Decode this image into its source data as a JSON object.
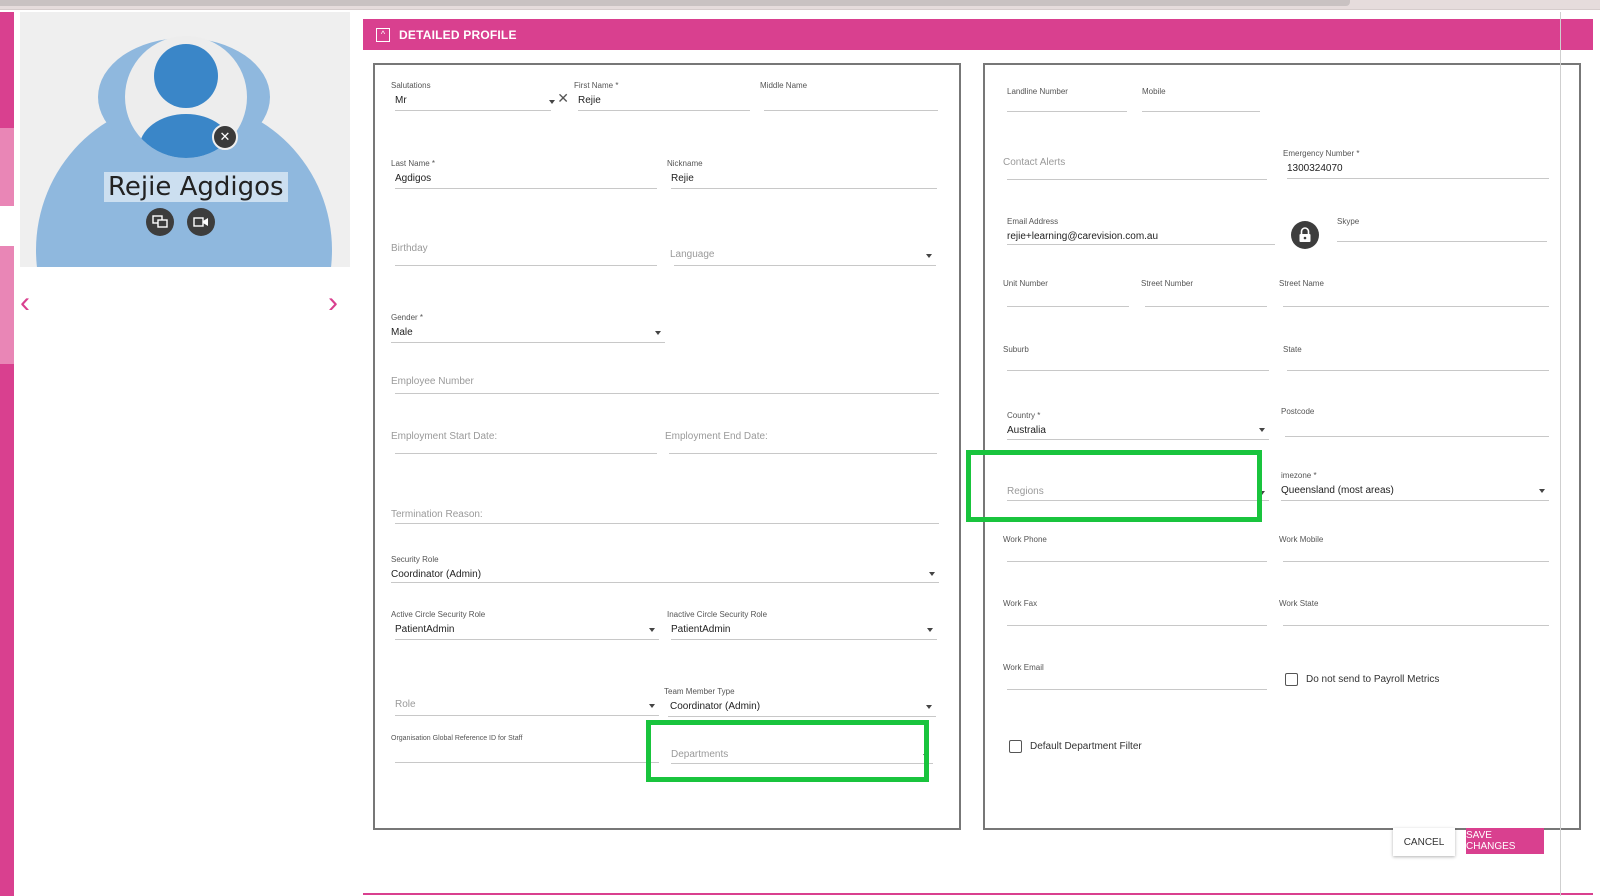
{
  "person": {
    "name": "Rejie Agdigos"
  },
  "panel": {
    "title": "DETAILED PROFILE"
  },
  "left": {
    "salutation": {
      "label": "Salutations",
      "value": "Mr"
    },
    "first_name": {
      "label": "First Name *",
      "value": "Rejie"
    },
    "middle_name": {
      "label": "Middle Name"
    },
    "last_name": {
      "label": "Last Name *",
      "value": "Agdigos"
    },
    "nickname": {
      "label": "Nickname",
      "value": "Rejie"
    },
    "birthday": {
      "placeholder": "Birthday"
    },
    "language": {
      "placeholder": "Language"
    },
    "gender": {
      "label": "Gender *",
      "value": "Male"
    },
    "employee_number": {
      "placeholder": "Employee Number"
    },
    "employment_start": {
      "placeholder": "Employment Start Date:"
    },
    "employment_end": {
      "placeholder": "Employment End Date:"
    },
    "termination_reason": {
      "placeholder": "Termination Reason:"
    },
    "security_role": {
      "label": "Security Role",
      "value": "Coordinator (Admin)"
    },
    "active_circle_role": {
      "label": "Active Circle Security Role",
      "value": "PatientAdmin"
    },
    "inactive_circle_role": {
      "label": "Inactive Circle Security Role",
      "value": "PatientAdmin"
    },
    "role": {
      "placeholder": "Role"
    },
    "team_member_type": {
      "label": "Team Member Type",
      "value": "Coordinator (Admin)"
    },
    "org_global_ref": {
      "label": "Organisation Global Reference ID for Staff"
    },
    "departments": {
      "placeholder": "Departments"
    }
  },
  "right": {
    "landline": {
      "label": "Landline Number"
    },
    "mobile": {
      "label": "Mobile"
    },
    "contact_alerts": {
      "placeholder": "Contact Alerts"
    },
    "emergency_number": {
      "label": "Emergency Number *",
      "value": "1300324070"
    },
    "email": {
      "label": "Email Address",
      "value": "rejie+learning@carevision.com.au"
    },
    "skype": {
      "label": "Skype"
    },
    "unit_number": {
      "label": "Unit Number"
    },
    "street_number": {
      "label": "Street Number"
    },
    "street_name": {
      "label": "Street Name"
    },
    "suburb": {
      "label": "Suburb"
    },
    "state": {
      "label": "State"
    },
    "country": {
      "label": "Country *",
      "value": "Australia"
    },
    "postcode": {
      "label": "Postcode"
    },
    "regions": {
      "placeholder": "Regions"
    },
    "timezone": {
      "label": "imezone *",
      "value": "Queensland (most areas)"
    },
    "work_phone": {
      "label": "Work Phone"
    },
    "work_mobile": {
      "label": "Work Mobile"
    },
    "work_fax": {
      "label": "Work Fax"
    },
    "work_state": {
      "label": "Work State"
    },
    "work_email": {
      "label": "Work Email"
    },
    "payroll_metrics": {
      "label": "Do not send to Payroll Metrics"
    },
    "default_department_filter": {
      "label": "Default Department Filter"
    }
  },
  "buttons": {
    "cancel": "CANCEL",
    "save": "SAVE CHANGES"
  },
  "colors": {
    "accent": "#d9408f",
    "highlight": "#19c43d",
    "avatar": "#3a86c8"
  }
}
